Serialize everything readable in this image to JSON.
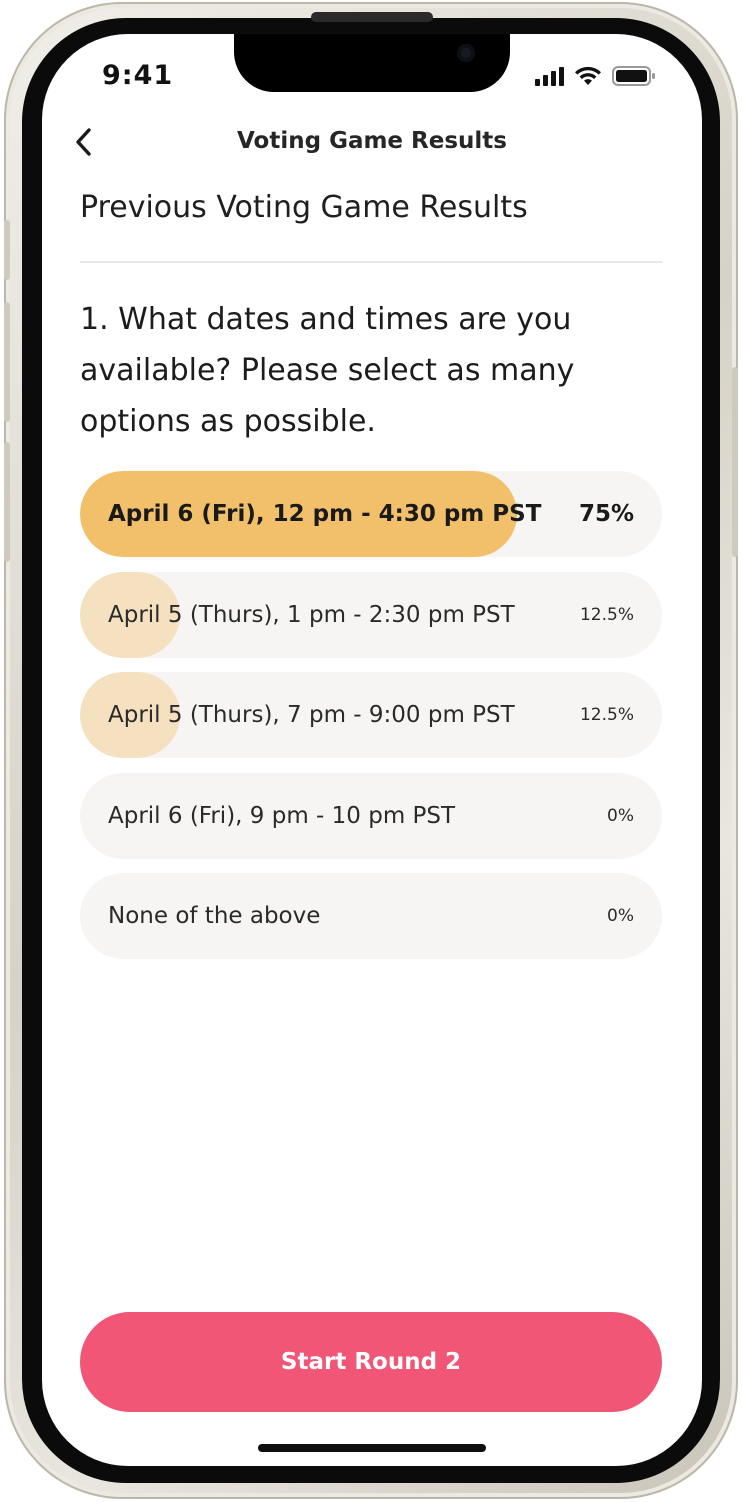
{
  "status_bar": {
    "time": "9:41"
  },
  "nav": {
    "title": "Voting Game Results"
  },
  "section": {
    "title": "Previous Voting Game Results"
  },
  "question": {
    "text": "1. What dates and times are you available? Please select as many options as possible."
  },
  "options": [
    {
      "label": "April 6 (Fri), 12 pm - 4:30 pm PST",
      "percent": "75%",
      "share": 0.75,
      "winner": true
    },
    {
      "label": "April 5 (Thurs), 1 pm - 2:30 pm PST",
      "percent": "12.5%",
      "share": 0.125,
      "winner": false
    },
    {
      "label": "April 5 (Thurs), 7 pm - 9:00 pm PST",
      "percent": "12.5%",
      "share": 0.125,
      "winner": false
    },
    {
      "label": "April 6 (Fri), 9 pm - 10 pm PST",
      "percent": "0%",
      "share": 0,
      "winner": false
    },
    {
      "label": "None of the above",
      "percent": "0%",
      "share": 0,
      "winner": false
    }
  ],
  "actions": {
    "start_round_label": "Start Round 2"
  },
  "colors": {
    "winner_fill": "#f2c06b",
    "other_fill": "#f5e1bf",
    "option_bg": "#f6f5f3",
    "primary_button": "#f25677"
  },
  "icons": {
    "back": "chevron-left-icon",
    "signal": "cellular-signal-icon",
    "wifi": "wifi-icon",
    "battery": "battery-icon"
  }
}
